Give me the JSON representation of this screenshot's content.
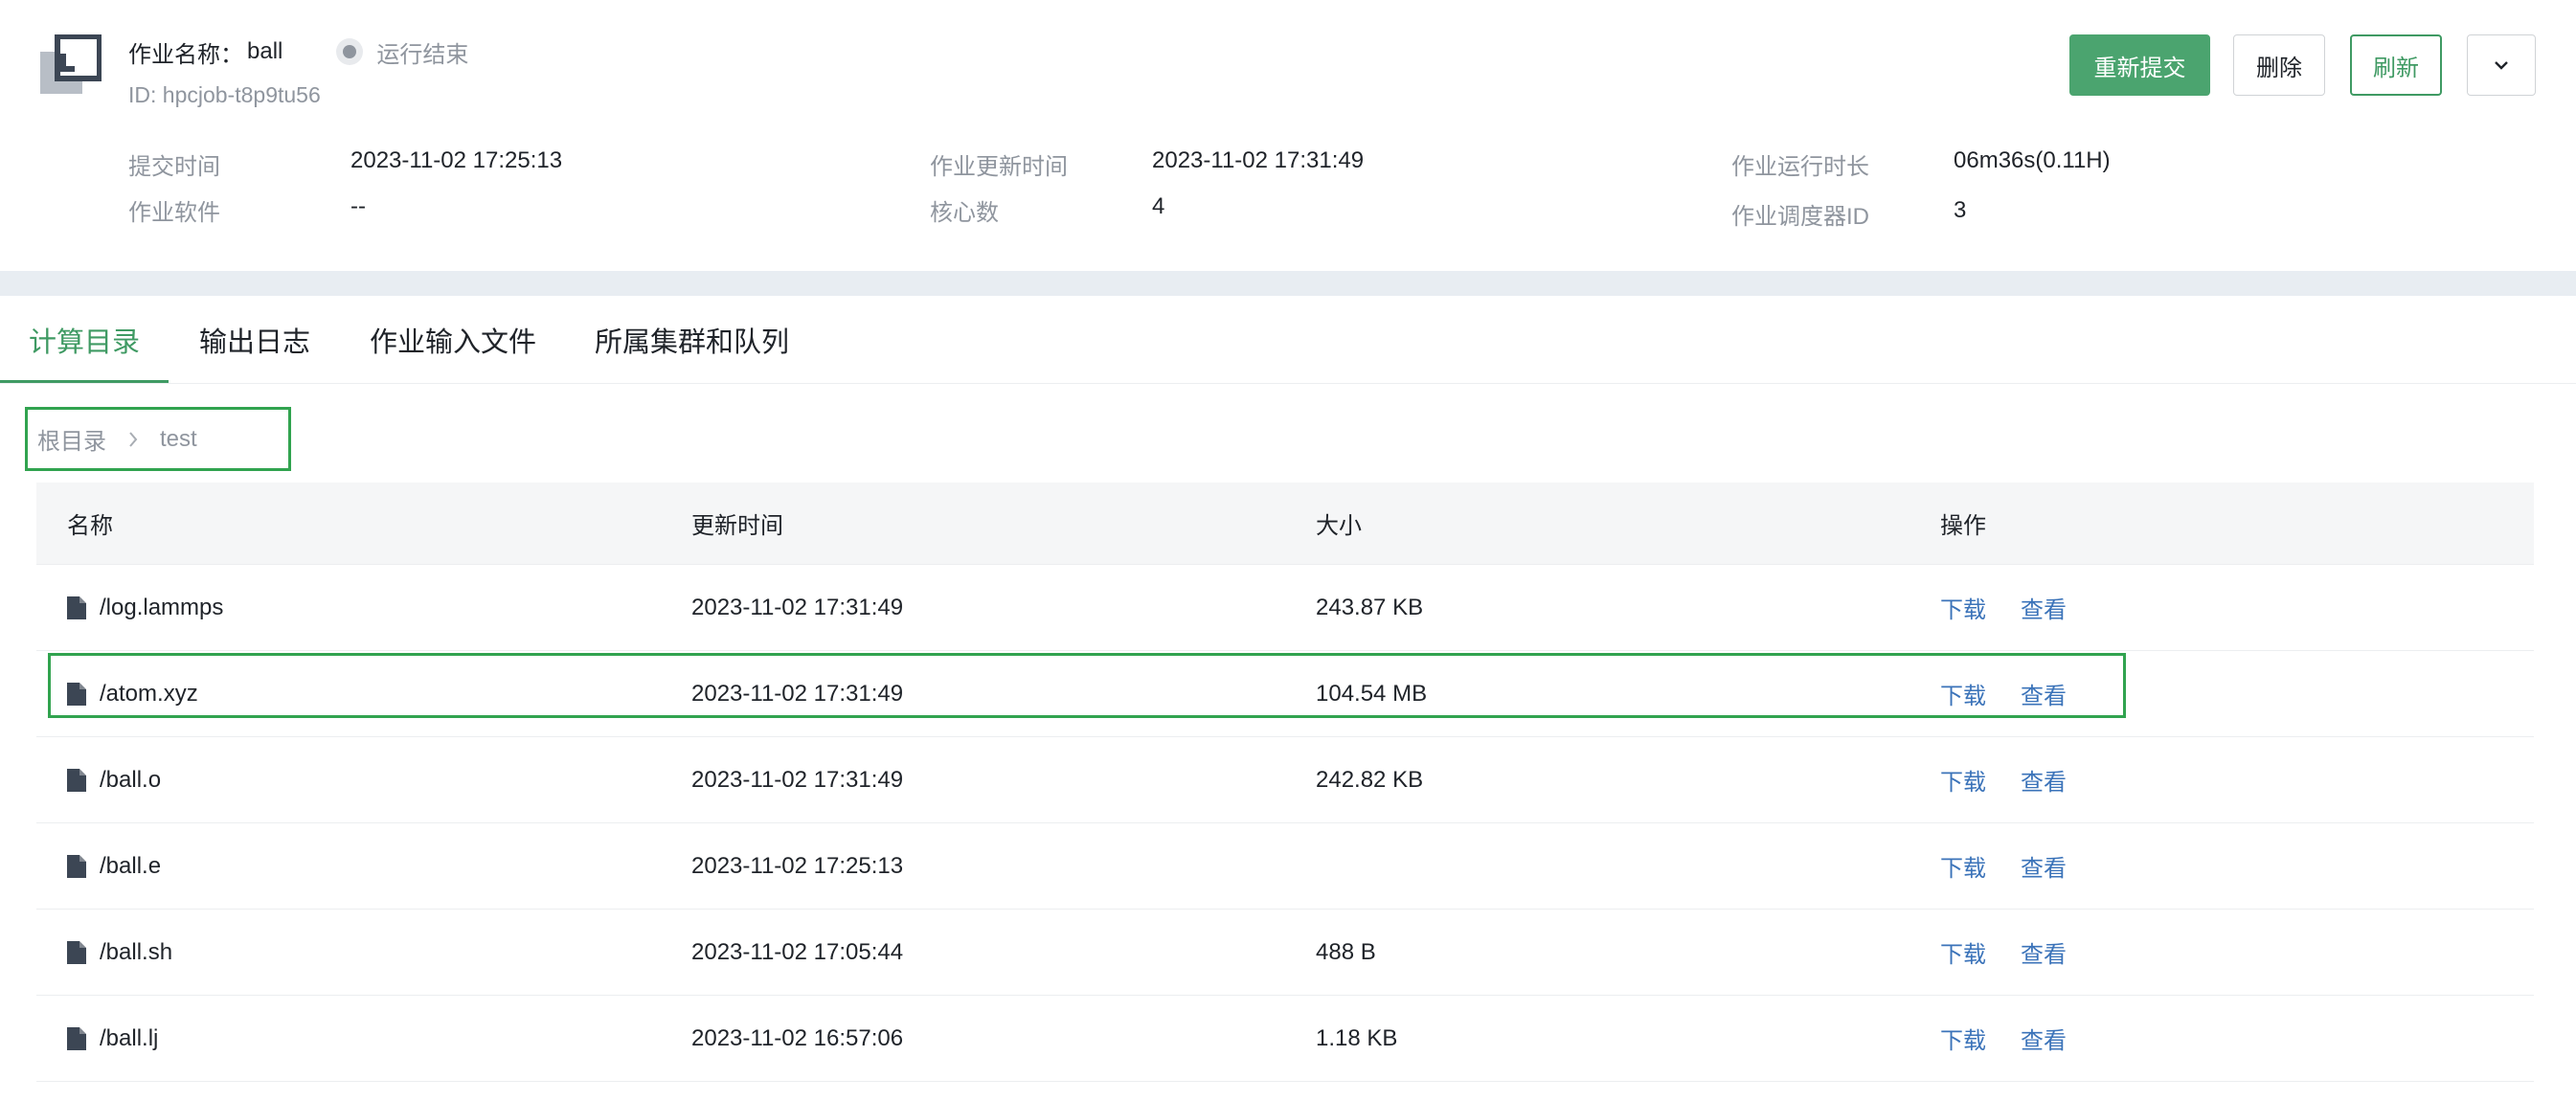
{
  "job": {
    "name_label": "作业名称：",
    "name": "ball",
    "status": "运行结束",
    "id_text": "ID: hpcjob-t8p9tu56"
  },
  "actions": {
    "resubmit": "重新提交",
    "delete": "删除",
    "refresh": "刷新"
  },
  "meta": {
    "submit_time_label": "提交时间",
    "submit_time": "2023-11-02 17:25:13",
    "software_label": "作业软件",
    "software": "--",
    "update_time_label": "作业更新时间",
    "update_time": "2023-11-02 17:31:49",
    "cores_label": "核心数",
    "cores": "4",
    "runtime_label": "作业运行时长",
    "runtime": "06m36s(0.11H)",
    "scheduler_id_label": "作业调度器ID",
    "scheduler_id": "3"
  },
  "tabs": [
    {
      "label": "计算目录",
      "active": true
    },
    {
      "label": "输出日志",
      "active": false
    },
    {
      "label": "作业输入文件",
      "active": false
    },
    {
      "label": "所属集群和队列",
      "active": false
    }
  ],
  "breadcrumb": {
    "root": "根目录",
    "current": "test"
  },
  "table": {
    "headers": {
      "name": "名称",
      "time": "更新时间",
      "size": "大小",
      "ops": "操作"
    },
    "op_download": "下载",
    "op_view": "查看",
    "rows": [
      {
        "name": "/log.lammps",
        "time": "2023-11-02 17:31:49",
        "size": "243.87 KB"
      },
      {
        "name": "/atom.xyz",
        "time": "2023-11-02 17:31:49",
        "size": "104.54 MB"
      },
      {
        "name": "/ball.o",
        "time": "2023-11-02 17:31:49",
        "size": "242.82 KB"
      },
      {
        "name": "/ball.e",
        "time": "2023-11-02 17:25:13",
        "size": ""
      },
      {
        "name": "/ball.sh",
        "time": "2023-11-02 17:05:44",
        "size": "488 B"
      },
      {
        "name": "/ball.lj",
        "time": "2023-11-02 16:57:06",
        "size": "1.18 KB"
      }
    ]
  },
  "colors": {
    "primary": "#4ba46f",
    "link": "#3b73b9",
    "highlight_border": "#31a34f"
  }
}
